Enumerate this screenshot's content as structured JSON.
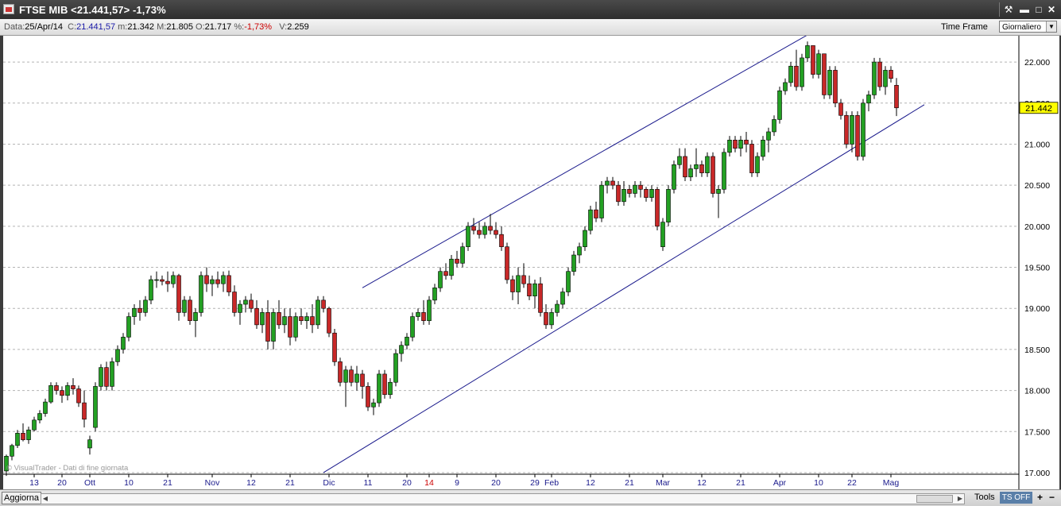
{
  "window": {
    "title": "FTSE MIB <21.441,57>  -1,73%",
    "buttons": [
      "tools-icon",
      "minimize-icon",
      "maximize-icon",
      "close-icon"
    ]
  },
  "info": {
    "data_label": "Data:",
    "data_value": "25/Apr/14",
    "close_label": "C:",
    "close_value": "21.441,57",
    "min_label": "m:",
    "min_value": "21.342",
    "max_label": "M:",
    "max_value": "21.805",
    "open_label": "O:",
    "open_value": "21.717",
    "pct_label": "%:",
    "pct_value": "-1,73%",
    "vol_label": "V:",
    "vol_value": "2.259",
    "timeframe_label": "Time Frame",
    "timeframe_value": "Giornaliero"
  },
  "colors": {
    "up": "#23a023",
    "down": "#c82828",
    "channel": "#1a1a8c",
    "grid": "#b4b4b4",
    "price_tag": "#ffff00"
  },
  "chart_data": {
    "type": "candlestick",
    "ylim": [
      16990,
      22320
    ],
    "y_ticks": [
      "22.000",
      "21.500",
      "21.000",
      "20.500",
      "20.000",
      "19.500",
      "19.000",
      "18.500",
      "18.000",
      "17.500",
      "17.000"
    ],
    "y_tick_values": [
      22000,
      21500,
      21000,
      20500,
      20000,
      19500,
      19000,
      18500,
      18000,
      17500,
      17000
    ],
    "last_price_label": "21.442",
    "last_price": 21442,
    "x_labels": [
      {
        "i": 5,
        "t": "13",
        "c": "#1a1a8c"
      },
      {
        "i": 10,
        "t": "20",
        "c": "#1a1a8c"
      },
      {
        "i": 15,
        "t": "Ott",
        "c": "#1a1a8c"
      },
      {
        "i": 22,
        "t": "10",
        "c": "#1a1a8c"
      },
      {
        "i": 29,
        "t": "21",
        "c": "#1a1a8c"
      },
      {
        "i": 37,
        "t": "Nov",
        "c": "#1a1a8c"
      },
      {
        "i": 44,
        "t": "12",
        "c": "#1a1a8c"
      },
      {
        "i": 51,
        "t": "21",
        "c": "#1a1a8c"
      },
      {
        "i": 58,
        "t": "Dic",
        "c": "#1a1a8c"
      },
      {
        "i": 65,
        "t": "11",
        "c": "#1a1a8c"
      },
      {
        "i": 72,
        "t": "20",
        "c": "#1a1a8c"
      },
      {
        "i": 76,
        "t": "14",
        "c": "#cc0000"
      },
      {
        "i": 81,
        "t": "9",
        "c": "#1a1a8c"
      },
      {
        "i": 88,
        "t": "20",
        "c": "#1a1a8c"
      },
      {
        "i": 95,
        "t": "29",
        "c": "#1a1a8c"
      },
      {
        "i": 98,
        "t": "Feb",
        "c": "#1a1a8c"
      },
      {
        "i": 105,
        "t": "12",
        "c": "#1a1a8c"
      },
      {
        "i": 112,
        "t": "21",
        "c": "#1a1a8c"
      },
      {
        "i": 118,
        "t": "Mar",
        "c": "#1a1a8c"
      },
      {
        "i": 125,
        "t": "12",
        "c": "#1a1a8c"
      },
      {
        "i": 132,
        "t": "21",
        "c": "#1a1a8c"
      },
      {
        "i": 139,
        "t": "Apr",
        "c": "#1a1a8c"
      },
      {
        "i": 146,
        "t": "10",
        "c": "#1a1a8c"
      },
      {
        "i": 152,
        "t": "22",
        "c": "#1a1a8c"
      },
      {
        "i": 159,
        "t": "Mag",
        "c": "#1a1a8c"
      }
    ],
    "channel_upper": [
      [
        64,
        19250
      ],
      [
        144,
        22330
      ]
    ],
    "channel_lower": [
      [
        57,
        17000
      ],
      [
        165,
        21480
      ]
    ],
    "candles": [
      [
        17020,
        17220,
        16960,
        17200
      ],
      [
        17200,
        17350,
        17150,
        17330
      ],
      [
        17330,
        17520,
        17300,
        17480
      ],
      [
        17480,
        17600,
        17380,
        17400
      ],
      [
        17400,
        17560,
        17350,
        17520
      ],
      [
        17520,
        17680,
        17500,
        17640
      ],
      [
        17640,
        17760,
        17600,
        17720
      ],
      [
        17720,
        17900,
        17680,
        17860
      ],
      [
        17860,
        18100,
        17840,
        18060
      ],
      [
        18060,
        18100,
        17950,
        18000
      ],
      [
        18000,
        18050,
        17850,
        17940
      ],
      [
        17940,
        18100,
        17880,
        18060
      ],
      [
        18060,
        18150,
        17950,
        18020
      ],
      [
        18020,
        18060,
        17800,
        17850
      ],
      [
        17850,
        18000,
        17550,
        17650
      ],
      [
        17300,
        17450,
        17220,
        17400
      ],
      [
        17550,
        18100,
        17500,
        18050
      ],
      [
        18050,
        18320,
        18000,
        18280
      ],
      [
        18280,
        18350,
        18000,
        18050
      ],
      [
        18050,
        18400,
        18000,
        18350
      ],
      [
        18350,
        18550,
        18300,
        18500
      ],
      [
        18500,
        18700,
        18450,
        18650
      ],
      [
        18650,
        18950,
        18600,
        18900
      ],
      [
        18900,
        19050,
        18800,
        19000
      ],
      [
        19000,
        19100,
        18850,
        18950
      ],
      [
        18950,
        19150,
        18900,
        19100
      ],
      [
        19100,
        19400,
        19050,
        19350
      ],
      [
        19350,
        19450,
        19250,
        19350
      ],
      [
        19350,
        19400,
        19280,
        19330
      ],
      [
        19330,
        19450,
        19200,
        19300
      ],
      [
        19300,
        19450,
        19250,
        19400
      ],
      [
        19400,
        19420,
        18850,
        18950
      ],
      [
        18950,
        19150,
        18900,
        19100
      ],
      [
        19100,
        19150,
        18800,
        18850
      ],
      [
        18850,
        19000,
        18650,
        18950
      ],
      [
        18950,
        19450,
        18900,
        19400
      ],
      [
        19400,
        19500,
        19200,
        19300
      ],
      [
        19300,
        19400,
        19150,
        19350
      ],
      [
        19350,
        19450,
        19250,
        19300
      ],
      [
        19300,
        19450,
        19200,
        19400
      ],
      [
        19400,
        19460,
        19150,
        19200
      ],
      [
        19200,
        19280,
        18900,
        18950
      ],
      [
        18950,
        19100,
        18800,
        19050
      ],
      [
        19050,
        19150,
        18950,
        19100
      ],
      [
        19100,
        19180,
        18950,
        19000
      ],
      [
        19000,
        19100,
        18750,
        18800
      ],
      [
        18800,
        19000,
        18700,
        18950
      ],
      [
        18950,
        19100,
        18500,
        18600
      ],
      [
        18600,
        19000,
        18500,
        18950
      ],
      [
        18950,
        19100,
        18750,
        18800
      ],
      [
        18800,
        19000,
        18700,
        18900
      ],
      [
        18900,
        19000,
        18550,
        18650
      ],
      [
        18650,
        18950,
        18600,
        18900
      ],
      [
        18900,
        19000,
        18800,
        18850
      ],
      [
        18850,
        18950,
        18750,
        18900
      ],
      [
        18900,
        19050,
        18700,
        18800
      ],
      [
        18800,
        19150,
        18750,
        19100
      ],
      [
        19100,
        19150,
        18950,
        19000
      ],
      [
        19000,
        19020,
        18650,
        18700
      ],
      [
        18700,
        18750,
        18300,
        18350
      ],
      [
        18350,
        18400,
        18050,
        18100
      ],
      [
        18100,
        18300,
        17800,
        18250
      ],
      [
        18250,
        18300,
        18050,
        18100
      ],
      [
        18100,
        18300,
        18000,
        18200
      ],
      [
        18200,
        18250,
        17900,
        18050
      ],
      [
        18050,
        18100,
        17750,
        17800
      ],
      [
        17800,
        17900,
        17700,
        17850
      ],
      [
        17850,
        18250,
        17800,
        18200
      ],
      [
        18200,
        18250,
        17900,
        17950
      ],
      [
        17950,
        18150,
        17900,
        18100
      ],
      [
        18100,
        18500,
        18050,
        18450
      ],
      [
        18450,
        18600,
        18350,
        18550
      ],
      [
        18550,
        18700,
        18500,
        18650
      ],
      [
        18650,
        18950,
        18600,
        18900
      ],
      [
        18900,
        19000,
        18850,
        18950
      ],
      [
        18950,
        19100,
        18800,
        18850
      ],
      [
        18850,
        19150,
        18800,
        19100
      ],
      [
        19100,
        19300,
        19050,
        19250
      ],
      [
        19250,
        19500,
        19200,
        19450
      ],
      [
        19450,
        19550,
        19350,
        19400
      ],
      [
        19400,
        19650,
        19350,
        19600
      ],
      [
        19600,
        19700,
        19500,
        19550
      ],
      [
        19550,
        19800,
        19500,
        19750
      ],
      [
        19750,
        20050,
        19700,
        20000
      ],
      [
        20000,
        20100,
        19900,
        19950
      ],
      [
        19950,
        20050,
        19850,
        19900
      ],
      [
        19900,
        20050,
        19850,
        20000
      ],
      [
        20000,
        20150,
        19900,
        19950
      ],
      [
        19950,
        20050,
        19850,
        19900
      ],
      [
        19900,
        20000,
        19700,
        19750
      ],
      [
        19750,
        19800,
        19300,
        19350
      ],
      [
        19350,
        19400,
        19100,
        19200
      ],
      [
        19200,
        19500,
        19050,
        19400
      ],
      [
        19400,
        19550,
        19250,
        19300
      ],
      [
        19300,
        19400,
        19100,
        19150
      ],
      [
        19150,
        19350,
        19000,
        19300
      ],
      [
        19300,
        19380,
        18900,
        18950
      ],
      [
        18950,
        19050,
        18750,
        18800
      ],
      [
        18800,
        19000,
        18750,
        18950
      ],
      [
        18950,
        19100,
        18900,
        19050
      ],
      [
        19050,
        19250,
        19000,
        19200
      ],
      [
        19200,
        19500,
        19150,
        19450
      ],
      [
        19450,
        19700,
        19400,
        19650
      ],
      [
        19650,
        19800,
        19550,
        19750
      ],
      [
        19750,
        20000,
        19700,
        19950
      ],
      [
        19950,
        20250,
        19900,
        20200
      ],
      [
        20200,
        20300,
        20050,
        20100
      ],
      [
        20100,
        20550,
        20050,
        20500
      ],
      [
        20500,
        20600,
        20400,
        20550
      ],
      [
        20550,
        20600,
        20450,
        20500
      ],
      [
        20500,
        20550,
        20250,
        20300
      ],
      [
        20300,
        20550,
        20250,
        20450
      ],
      [
        20450,
        20500,
        20350,
        20400
      ],
      [
        20400,
        20550,
        20350,
        20500
      ],
      [
        20500,
        20550,
        20350,
        20450
      ],
      [
        20450,
        20480,
        20300,
        20350
      ],
      [
        20350,
        20500,
        20300,
        20450
      ],
      [
        20450,
        20480,
        19950,
        20000
      ],
      [
        19750,
        20100,
        19700,
        20050
      ],
      [
        20050,
        20500,
        20000,
        20450
      ],
      [
        20450,
        20800,
        20400,
        20750
      ],
      [
        20750,
        20950,
        20700,
        20850
      ],
      [
        20850,
        20950,
        20550,
        20600
      ],
      [
        20600,
        20750,
        20550,
        20700
      ],
      [
        20700,
        20950,
        20600,
        20750
      ],
      [
        20750,
        20800,
        20600,
        20650
      ],
      [
        20650,
        20900,
        20600,
        20850
      ],
      [
        20850,
        20900,
        20350,
        20400
      ],
      [
        20400,
        20500,
        20100,
        20450
      ],
      [
        20450,
        20950,
        20400,
        20900
      ],
      [
        20900,
        21100,
        20850,
        21050
      ],
      [
        21050,
        21100,
        20900,
        20950
      ],
      [
        20950,
        21100,
        20850,
        21050
      ],
      [
        21050,
        21150,
        20900,
        21000
      ],
      [
        21000,
        21050,
        20600,
        20650
      ],
      [
        20650,
        20900,
        20600,
        20850
      ],
      [
        20850,
        21100,
        20800,
        21050
      ],
      [
        21050,
        21200,
        20900,
        21150
      ],
      [
        21150,
        21350,
        21100,
        21300
      ],
      [
        21300,
        21700,
        21250,
        21650
      ],
      [
        21650,
        21800,
        21600,
        21750
      ],
      [
        21750,
        22000,
        21700,
        21950
      ],
      [
        21950,
        22150,
        21650,
        21700
      ],
      [
        21700,
        22100,
        21650,
        22050
      ],
      [
        22050,
        22250,
        22000,
        22200
      ],
      [
        22200,
        22200,
        21800,
        21850
      ],
      [
        21850,
        22150,
        21800,
        22100
      ],
      [
        22100,
        22100,
        21550,
        21600
      ],
      [
        21600,
        21950,
        21550,
        21900
      ],
      [
        21900,
        21950,
        21450,
        21500
      ],
      [
        21500,
        21550,
        21300,
        21350
      ],
      [
        21350,
        21400,
        20950,
        21000
      ],
      [
        21000,
        21400,
        20900,
        21350
      ],
      [
        21350,
        21400,
        20800,
        20850
      ],
      [
        20850,
        21550,
        20800,
        21500
      ],
      [
        21500,
        21650,
        21400,
        21600
      ],
      [
        21600,
        22050,
        21550,
        22000
      ],
      [
        22000,
        22050,
        21650,
        21700
      ],
      [
        21700,
        21950,
        21600,
        21900
      ],
      [
        21900,
        21950,
        21750,
        21800
      ],
      [
        21717,
        21805,
        21342,
        21442
      ]
    ]
  },
  "watermark": "© VisualTrader - Dati di fine giornata",
  "bottom": {
    "refresh_label": "Aggiorna",
    "tools_label": "Tools",
    "ts_label": "TS OFF",
    "zoom_in": "+",
    "zoom_out": "−"
  }
}
